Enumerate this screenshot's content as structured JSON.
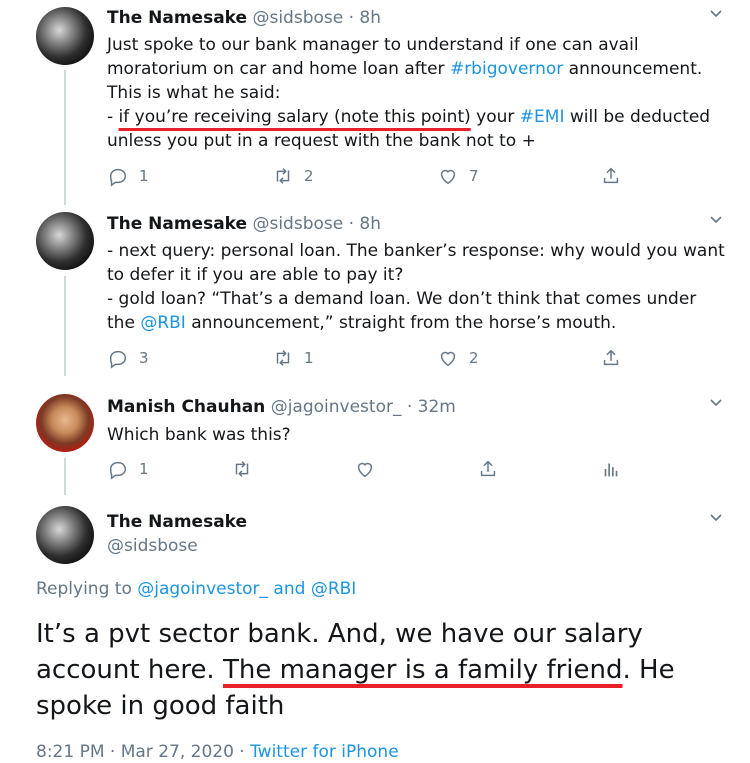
{
  "tweets": [
    {
      "name": "The Namesake",
      "handle": "@sidsbose",
      "time": " · 8h",
      "text_pre": "Just spoke to our bank manager to understand if one can avail moratorium on car and home loan after ",
      "hashtag1": "#rbigovernor",
      "text_mid": " announcement. This is what he said:",
      "line2_prefix": "- ",
      "underlined": "if you’re receiving salary (note this point)",
      "line2_mid": " your ",
      "hashtag2": "#EMI",
      "line2_end": " will be deducted unless you put in a request with the bank not to +",
      "replies": "1",
      "retweets": "2",
      "likes": "7"
    },
    {
      "name": "The Namesake",
      "handle": "@sidsbose",
      "time": " · 8h",
      "line1": "- next query: personal loan. The banker’s response: why would you want to defer it if you are able to pay it?",
      "line2_pre": "- gold loan? “That’s a demand loan. We don’t think that comes under the ",
      "mention": "@RBI",
      "line2_end": " announcement,” straight from the horse’s mouth.",
      "replies": "3",
      "retweets": "1",
      "likes": "2"
    },
    {
      "name": "Manish Chauhan",
      "handle": "@jagoinvestor_",
      "time": " · 32m",
      "text": "Which bank was this?",
      "replies": "1"
    }
  ],
  "main": {
    "name": "The Namesake",
    "handle": "@sidsbose",
    "replying_prefix": "Replying to ",
    "reply_mention1": "@jagoinvestor_",
    "reply_and": " and ",
    "reply_mention2": "@RBI",
    "text_pre": "It’s a pvt sector bank. And, we have our salary account here. ",
    "underlined": "The manager is a family friend",
    "text_post": ". He spoke in good faith",
    "time": "8:21 PM · Mar 27, 2020 · ",
    "source": "Twitter for iPhone"
  },
  "icons": [
    "chevron-down-icon",
    "reply-icon",
    "retweet-icon",
    "like-icon",
    "share-icon",
    "analytics-icon"
  ],
  "colors": {
    "link": "#1b95e0",
    "secondary": "#657786",
    "underline": "#e8202a"
  }
}
